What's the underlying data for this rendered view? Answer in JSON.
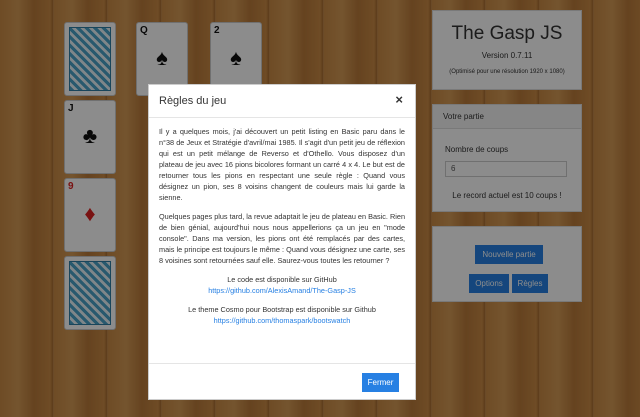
{
  "app": {
    "title": "The Gasp JS",
    "version": "Version 0.7.11",
    "optimized": "(Optimisé pour une résolution 1920 x 1080)"
  },
  "party": {
    "header": "Votre partie",
    "coups_label": "Nombre de coups",
    "coups_value": "6",
    "record": "Le record actuel est 10 coups !"
  },
  "buttons": {
    "new_game": "Nouvelle partie",
    "options": "Options",
    "rules": "Règles"
  },
  "cards": [
    {
      "type": "back"
    },
    {
      "type": "face",
      "rank": "Q",
      "suit": "♠",
      "color": "black"
    },
    {
      "type": "face",
      "rank": "2",
      "suit": "♠",
      "color": "black"
    },
    {
      "type": "face",
      "rank": "J",
      "suit": "♣",
      "color": "black"
    },
    {
      "type": "face",
      "rank": "9",
      "suit": "♦",
      "color": "red"
    },
    {
      "type": "back"
    }
  ],
  "modal": {
    "title": "Règles du jeu",
    "close_icon": "×",
    "p1": "Il y a quelques mois, j'ai découvert un petit listing en Basic paru dans le n°38 de Jeux et Stratégie d'avril/mai 1985. Il s'agit d'un petit jeu de réflexion qui est un petit mélange de Reverso et d'Othello. Vous disposez d'un plateau de jeu avec 16 pions bicolores formant un carré 4 x 4. Le but est de retourner tous les pions en respectant une seule règle : Quand vous désignez un pion, ses 8 voisins changent de couleurs mais lui garde la sienne.",
    "p2": "Quelques pages plus tard, la revue adaptait le jeu de plateau en Basic. Rien de bien génial, aujourd'hui nous nous appellerions ça un jeu en \"mode console\". Dans ma version, les pions ont été remplacés par des cartes, mais le principe est toujours le même : Quand vous désignez une carte, ses 8 voisines sont retournées sauf elle. Saurez-vous toutes les retourner ?",
    "code_text": "Le code est disponible sur GitHub",
    "code_link": "https://github.com/AlexisAmand/The-Gasp-JS",
    "theme_text": "Le theme Cosmo pour Bootstrap est disponible sur Github",
    "theme_link": "https://github.com/thomaspark/bootswatch",
    "close_button": "Fermer"
  },
  "colors": {
    "primary": "#2780e3",
    "overlay": "rgba(0,0,0,0.45)"
  }
}
